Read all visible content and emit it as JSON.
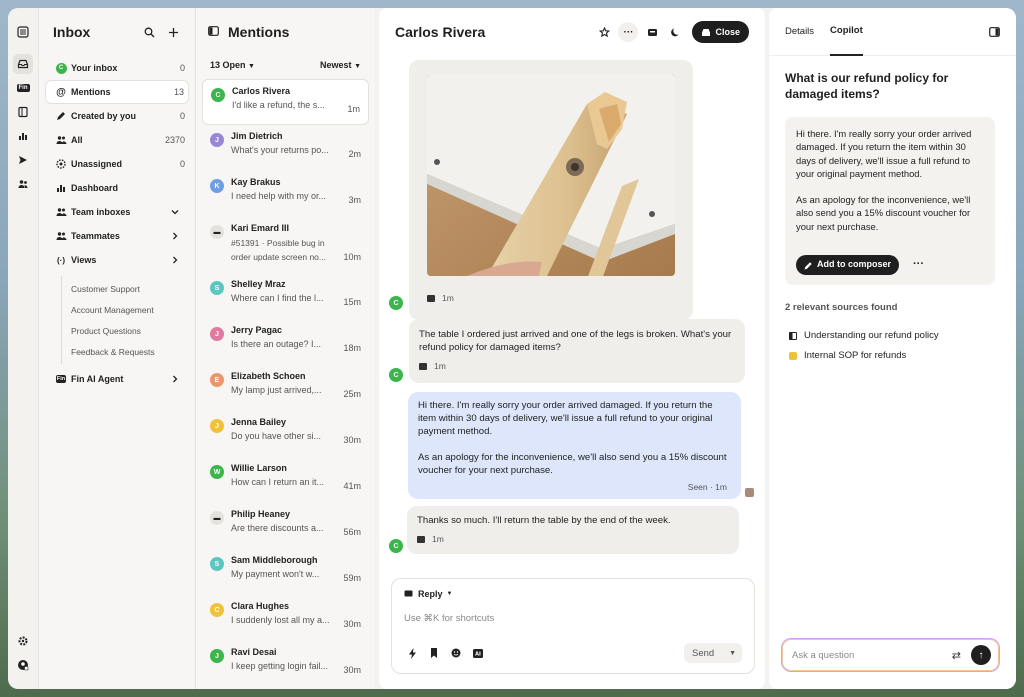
{
  "rail": {
    "icons": [
      "inbox-icon",
      "fin-icon",
      "book-icon",
      "reports-icon",
      "outbound-icon",
      "contacts-icon"
    ],
    "fin_label": "Fin",
    "bottom": [
      "settings-icon",
      "account-icon"
    ]
  },
  "inbox": {
    "title": "Inbox",
    "items": [
      {
        "label": "Your inbox",
        "count": "0"
      },
      {
        "label": "Mentions",
        "count": "13"
      },
      {
        "label": "Created by you",
        "count": "0"
      },
      {
        "label": "All",
        "count": "2370"
      },
      {
        "label": "Unassigned",
        "count": "0"
      },
      {
        "label": "Dashboard",
        "count": ""
      },
      {
        "label": "Team inboxes",
        "count": ""
      },
      {
        "label": "Teammates",
        "count": ""
      },
      {
        "label": "Views",
        "count": ""
      }
    ],
    "views": [
      "Customer Support",
      "Account Management",
      "Product Questions",
      "Feedback & Requests"
    ],
    "fin_agent": "Fin AI Agent",
    "fin_badge": "Fin",
    "your_inbox_avatar": "C"
  },
  "mentions": {
    "title": "Mentions",
    "filter_open": "13 Open",
    "filter_sort": "Newest",
    "conversations": [
      {
        "name": "Carlos Rivera",
        "preview": "I'd like a refund, the s...",
        "time": "1m",
        "initial": "C",
        "color": "#3cb54a"
      },
      {
        "name": "Jim Dietrich",
        "preview": "What's your returns po...",
        "time": "2m",
        "initial": "J",
        "color": "#9a86d6"
      },
      {
        "name": "Kay Brakus",
        "preview": "I need help with my or...",
        "time": "3m",
        "initial": "K",
        "color": "#6f9fe0"
      },
      {
        "name": "Kari Emard III",
        "preview": "#51391 · Possible bug in",
        "preview2": "order update screen no...",
        "time": "10m",
        "initial": "",
        "color": "#333333"
      },
      {
        "name": "Shelley Mraz",
        "preview": "Where can I find the l...",
        "time": "15m",
        "initial": "S",
        "color": "#5cc7c0"
      },
      {
        "name": "Jerry Pagac",
        "preview": "Is there an outage? I...",
        "time": "18m",
        "initial": "J",
        "color": "#e07aa0"
      },
      {
        "name": "Elizabeth Schoen",
        "preview": "My lamp just arrived,...",
        "time": "25m",
        "initial": "E",
        "color": "#e59a6c"
      },
      {
        "name": "Jenna Bailey",
        "preview": "Do you have other si...",
        "time": "30m",
        "initial": "J",
        "color": "#f0c23a"
      },
      {
        "name": "Willie Larson",
        "preview": "How can I return an it...",
        "time": "41m",
        "initial": "W",
        "color": "#3cb54a"
      },
      {
        "name": "Philip Heaney",
        "preview": "Are there discounts a...",
        "time": "56m",
        "initial": "",
        "color": "#333333"
      },
      {
        "name": "Sam Middleborough",
        "preview": "My payment won't w...",
        "time": "59m",
        "initial": "S",
        "color": "#5cc7c0"
      },
      {
        "name": "Clara Hughes",
        "preview": "I suddenly lost all my a...",
        "time": "30m",
        "initial": "C",
        "color": "#f0c23a"
      },
      {
        "name": "Ravi Desai",
        "preview": "I keep getting login fail...",
        "time": "30m",
        "initial": "J",
        "color": "#3cb54a"
      }
    ]
  },
  "chat": {
    "title": "Carlos Rivera",
    "close_label": "Close",
    "avatar_initial": "C",
    "image_time": "1m",
    "msg1": "The table I ordered just arrived and one of the legs is broken. What's your refund policy for damaged items?",
    "msg1_time": "1m",
    "reply_p1": "Hi there. I'm really sorry your order arrived damaged. If you return the item within 30 days of delivery, we'll issue a full refund to your original payment method.",
    "reply_p2": "As an apology for the inconvenience, we'll also send you a 15% discount voucher for your next purchase.",
    "reply_meta": "Seen · 1m",
    "msg2": "Thanks so much. I'll return the table by the end of the week.",
    "msg2_time": "1m",
    "composer": {
      "mode": "Reply",
      "placeholder": "Use ⌘K for shortcuts",
      "send": "Send",
      "tools": [
        "bolt-icon",
        "bookmark-icon",
        "emoji-icon",
        "ai-icon"
      ]
    }
  },
  "copilot": {
    "tabs": [
      "Details",
      "Copilot"
    ],
    "active_tab": "Copilot",
    "question": "What is our refund policy for damaged items?",
    "answer_p1": "Hi there. I'm really sorry your order arrived damaged. If you return the item within 30 days of delivery, we'll issue a full refund to your original payment method.",
    "answer_p2": "As an apology for the inconvenience, we'll also send you a 15% discount voucher for your next purchase.",
    "add_button": "Add to composer",
    "more": "···",
    "sources_title": "2 relevant sources found",
    "sources": [
      "Understanding our refund policy",
      "Internal SOP for refunds"
    ],
    "ask_placeholder": "Ask a question"
  }
}
